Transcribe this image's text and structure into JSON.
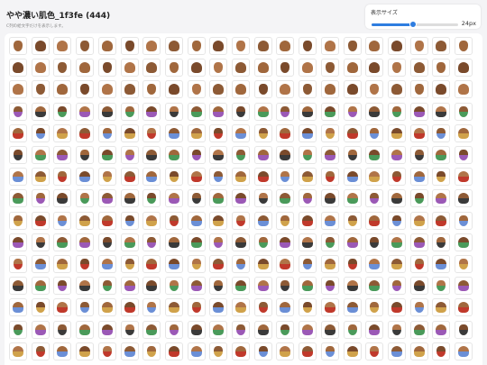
{
  "header": {
    "title": "やや濃い肌色_1f3fe (444)",
    "subtitle": "C列の絵文字だけを表示します。"
  },
  "size_control": {
    "label": "表示サイズ",
    "value_text": "24px",
    "fraction": 0.48,
    "accent_color": "#2e7de0"
  },
  "grid": {
    "total_count": 444,
    "cell_icon": "dark-skin-emoji-icon",
    "palette": [
      "#a0673c",
      "#8d5a35",
      "#b07448",
      "#7a4a2b",
      "#6b8fd6",
      "#4a9a5a",
      "#d0a24b",
      "#9b59b6",
      "#c0392b",
      "#3a3a3a"
    ]
  }
}
